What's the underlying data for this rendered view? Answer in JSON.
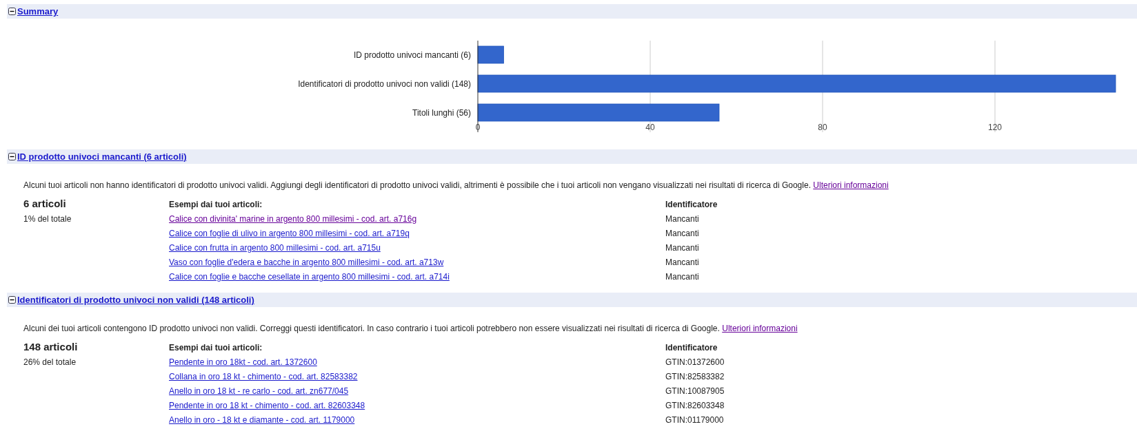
{
  "sections": [
    {
      "title": "Summary",
      "expanded": true,
      "chart_data": {
        "type": "bar",
        "orientation": "horizontal",
        "categories": [
          "ID prodotto univoci mancanti (6)",
          "Identificatori di prodotto univoci non validi (148)",
          "Titoli lunghi (56)"
        ],
        "series": [
          {
            "color": "#3366cc",
            "values": [
              6,
              148,
              56
            ]
          }
        ],
        "xlim": [
          0,
          148
        ],
        "xticks": [
          0,
          40,
          80,
          120
        ],
        "grid": true
      }
    },
    {
      "title": "ID prodotto univoci mancanti (6 articoli)",
      "expanded": true,
      "description": "Alcuni tuoi articoli non hanno identificatori di prodotto univoci validi. Aggiungi degli identificatori di prodotto univoci validi, altrimenti è possibile che i tuoi articoli non vengano visualizzati nei risultati di ricerca di Google.",
      "more_link": {
        "label": "Ulteriori informazioni",
        "visited": true
      },
      "count": "6 articoli",
      "share": "1% del totale",
      "columns": [
        "Esempi dai tuoi articoli:",
        "Identificatore"
      ],
      "rows": [
        {
          "item": "Calice con divinita' marine in argento 800 millesimi - cod. art. a716g",
          "visited": true,
          "identifier": "Mancanti"
        },
        {
          "item": "Calice con foglie di ulivo in argento 800 millesimi - cod. art. a719q",
          "visited": false,
          "identifier": "Mancanti"
        },
        {
          "item": "Calice con frutta in argento 800 millesimi - cod. art. a715u",
          "visited": false,
          "identifier": "Mancanti"
        },
        {
          "item": "Vaso con foglie d'edera e bacche in argento 800 millesimi - cod. art. a713w",
          "visited": false,
          "identifier": "Mancanti"
        },
        {
          "item": "Calice con foglie e bacche cesellate in argento 800 millesimi - cod. art. a714i",
          "visited": false,
          "identifier": "Mancanti"
        }
      ]
    },
    {
      "title": "Identificatori di prodotto univoci non validi (148 articoli)",
      "expanded": true,
      "description": "Alcuni dei tuoi articoli contengono ID prodotto univoci non validi. Correggi questi identificatori. In caso contrario i tuoi articoli potrebbero non essere visualizzati nei risultati di ricerca di Google.",
      "more_link": {
        "label": "Ulteriori informazioni",
        "visited": true
      },
      "count": "148 articoli",
      "share": "26% del totale",
      "columns": [
        "Esempi dai tuoi articoli:",
        "Identificatore"
      ],
      "rows": [
        {
          "item": "Pendente in oro 18kt - cod. art. 1372600",
          "visited": false,
          "identifier": "GTIN:01372600"
        },
        {
          "item": "Collana in oro 18 kt - chimento - cod. art. 82583382",
          "visited": false,
          "identifier": "GTIN:82583382"
        },
        {
          "item": "Anello in oro 18 kt - re carlo - cod. art. zn677/045",
          "visited": false,
          "identifier": "GTIN:10087905"
        },
        {
          "item": "Pendente in oro 18 kt - chimento - cod. art. 82603348",
          "visited": false,
          "identifier": "GTIN:82603348"
        },
        {
          "item": "Anello in oro - 18 kt e diamante - cod. art. 1179000",
          "visited": false,
          "identifier": "GTIN:01179000"
        }
      ]
    }
  ]
}
